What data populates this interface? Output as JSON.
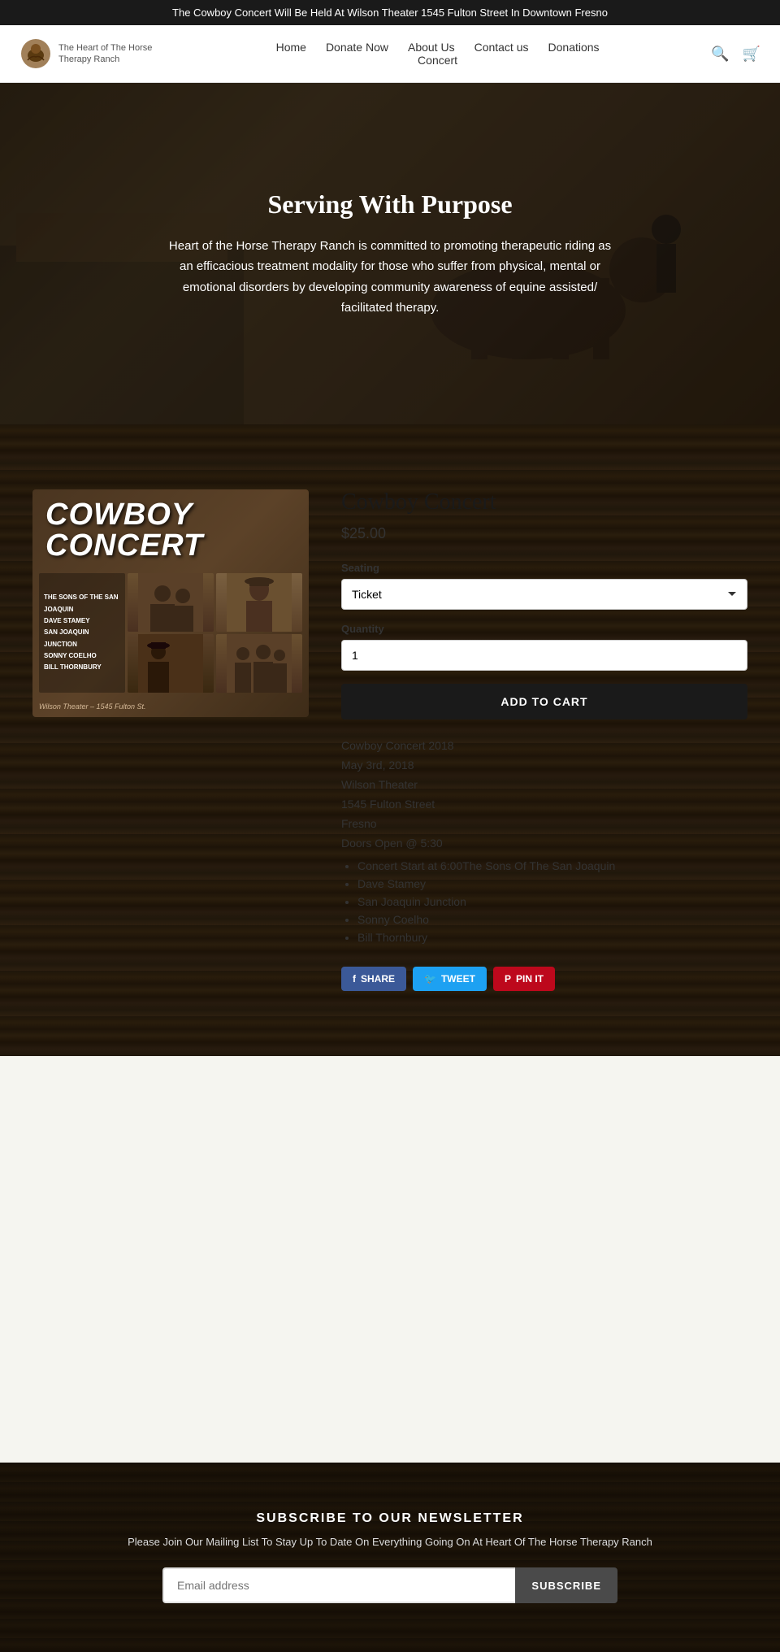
{
  "announcement": {
    "text": "The Cowboy Concert Will Be Held At Wilson Theater  1545 Fulton Street In Downtown Fresno"
  },
  "header": {
    "logo_text": "The Heart of The Horse Therapy Ranch",
    "nav": {
      "row1": [
        {
          "label": "Home",
          "id": "home"
        },
        {
          "label": "Donate Now",
          "id": "donate"
        },
        {
          "label": "About Us",
          "id": "about"
        },
        {
          "label": "Contact us",
          "id": "contact"
        },
        {
          "label": "Donations",
          "id": "donations"
        }
      ],
      "row2": [
        {
          "label": "Concert",
          "id": "concert"
        }
      ]
    },
    "search_label": "🔍",
    "cart_label": "🛒"
  },
  "hero": {
    "title": "Serving With Purpose",
    "description": "Heart of the Horse Therapy Ranch is committed to promoting therapeutic riding as an efficacious treatment modality for those who suffer from physical, mental or emotional disorders by developing community awareness of equine assisted/ facilitated therapy."
  },
  "product": {
    "title": "Cowboy Concert",
    "price": "$25.00",
    "seating_label": "Seating",
    "seating_option": "Ticket",
    "seating_options": [
      "Ticket"
    ],
    "quantity_label": "Quantity",
    "quantity_value": "1",
    "add_to_cart": "ADD TO CART",
    "event_name": "Cowboy Concert 2018",
    "event_date": "May 3rd, 2018",
    "venue_name": "Wilson Theater",
    "venue_address": "1545 Fulton Street",
    "venue_city": "Fresno",
    "doors_open": "Doors Open @ 5:30",
    "performers": [
      "Concert Start at 6:00The Sons Of The San Joaquin",
      "Dave Stamey",
      "San Joaquin Junction",
      "Sonny Coelho",
      "Bill Thornbury"
    ],
    "poster_title": "COWBOY CONCERT",
    "poster_performers": [
      "The Sons of The San Joaquin",
      "Dave Stamey",
      "San Joaquin Junction",
      "Sonny Coelho",
      "Bill Thornbury"
    ],
    "poster_venue": "Wilson Theater – 1545 Fulton St."
  },
  "social": {
    "facebook": "SHARE",
    "twitter": "TWEET",
    "pinterest": "PIN IT"
  },
  "newsletter": {
    "title": "SUBSCRIBE TO OUR NEWSLETTER",
    "description": "Please Join Our Mailing List To Stay Up To Date On Everything Going On At Heart Of The Horse Therapy Ranch",
    "email_placeholder": "Email address",
    "subscribe_label": "SUBSCRIBE"
  }
}
